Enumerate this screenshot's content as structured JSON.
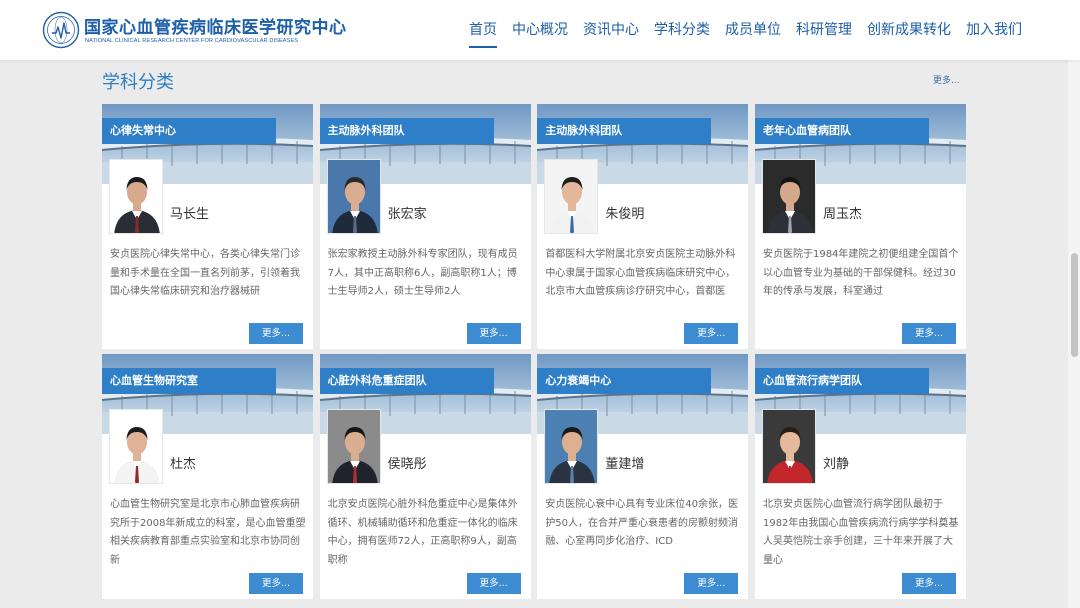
{
  "header": {
    "logo_cn": "国家心血管疾病临床医学研究中心",
    "logo_en": "NATIONAL CLINICAL RESEARCH CENTER FOR CARDIOVASCULAR DISEASES",
    "nav": [
      {
        "label": "首页",
        "active": true
      },
      {
        "label": "中心概况",
        "active": false
      },
      {
        "label": "资讯中心",
        "active": false
      },
      {
        "label": "学科分类",
        "active": false
      },
      {
        "label": "成员单位",
        "active": false
      },
      {
        "label": "科研管理",
        "active": false
      },
      {
        "label": "创新成果转化",
        "active": false
      },
      {
        "label": "加入我们",
        "active": false
      }
    ]
  },
  "section": {
    "title": "学科分类",
    "more": "更多..."
  },
  "cards": [
    {
      "tag": "心律失常中心",
      "name": "马长生",
      "desc": "安贞医院心律失常中心，各类心律失常门诊量和手术量在全国一直名列前茅，引领着我国心律失常临床研究和治疗器械研",
      "more": "更多..."
    },
    {
      "tag": "主动脉外科团队",
      "name": "张宏家",
      "desc": "张宏家教授主动脉外科专家团队，现有成员7人，其中正高职称6人，副高职称1人；博士生导师2人，硕士生导师2人",
      "more": "更多..."
    },
    {
      "tag": "主动脉外科团队",
      "name": "朱俊明",
      "desc": "首都医科大学附属北京安贞医院主动脉外科中心隶属于国家心血管疾病临床研究中心，北京市大血管疾病诊疗研究中心，首都医",
      "more": "更多..."
    },
    {
      "tag": "老年心血管病团队",
      "name": "周玉杰",
      "desc": "安贞医院于1984年建院之初便组建全国首个以心血管专业为基础的干部保健科。经过30年的传承与发展，科室通过",
      "more": "更多..."
    },
    {
      "tag": "心血管生物研究室",
      "name": "杜杰",
      "desc": "心血管生物研究室是北京市心肺血管疾病研究所于2008年新成立的科室，是心血管重塑相关疾病教育部重点实验室和北京市协同创新",
      "more": "更多..."
    },
    {
      "tag": "心脏外科危重症团队",
      "name": "侯晓彤",
      "desc": "北京安贞医院心脏外科危重症中心是集体外循环、机械辅助循环和危重症一体化的临床中心，拥有医师72人，正高职称9人，副高职称",
      "more": "更多..."
    },
    {
      "tag": "心力衰竭中心",
      "name": "董建增",
      "desc": "安贞医院心衰中心具有专业床位40余张，医护50人，在合并严重心衰患者的房颤射频消融、心室再同步化治疗、ICD",
      "more": "更多..."
    },
    {
      "tag": "心血管流行病学团队",
      "name": "刘静",
      "desc": "北京安贞医院心血管流行病学团队最初于1982年由我国心血管疾病流行病学学科奠基人吴英恺院士亲手创建，三十年来开展了大量心",
      "more": "更多..."
    }
  ],
  "colors": {
    "brand_blue": "#1d5fa8",
    "tag_blue": "#2e7fc8",
    "button_blue": "#3d8bd0",
    "page_bg": "#ebebeb"
  }
}
